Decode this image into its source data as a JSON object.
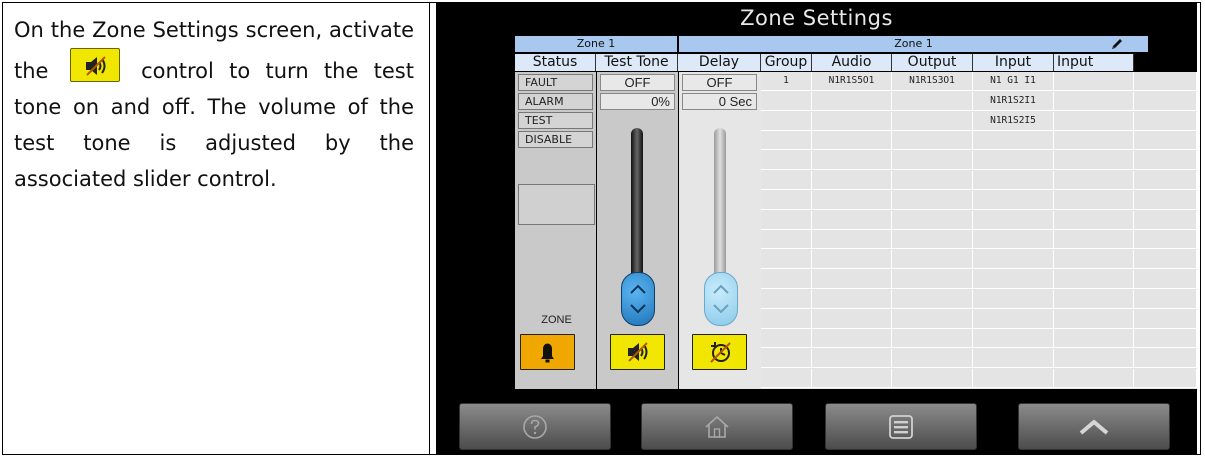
{
  "instruction": {
    "text_before": "On the Zone Settings screen, activate the",
    "text_after": "control to turn the test tone on and off. The volume of the test tone is adjusted by the associated slider control."
  },
  "screen": {
    "title": "Zone Settings",
    "left_zone_header": "Zone 1",
    "right_zone_header": "Zone 1",
    "columns": [
      "Status",
      "Test Tone",
      "Delay",
      "Group",
      "Audio",
      "Output",
      "Input",
      "Input"
    ],
    "status_buttons": [
      "FAULT",
      "ALARM",
      "TEST",
      "DISABLE"
    ],
    "test_tone": {
      "state": "OFF",
      "volume": "0%"
    },
    "delay": {
      "state": "OFF",
      "value": "0 Sec"
    },
    "zone_label": "ZONE",
    "rows": [
      [
        "1",
        "N1R1S5O1",
        "N1R1S3O1",
        "N1 G1 I1",
        ""
      ],
      [
        "",
        "",
        "",
        "N1R1S2I1",
        ""
      ],
      [
        "",
        "",
        "",
        "N1R1S2I5",
        ""
      ]
    ],
    "colors": {
      "accent_yellow": "#f1e600",
      "zone_orange": "#f0a800",
      "header_blue": "#a8c8f0",
      "slider_blue": "#2a8fd6"
    }
  },
  "icons": {
    "test_tone_button": "speaker-mute-icon",
    "zone_button": "bell-icon",
    "delay_button": "delay-timer-icon",
    "edit": "pencil-icon",
    "nav": [
      "help-icon",
      "home-icon",
      "menu-icon",
      "chevron-up-icon"
    ]
  }
}
